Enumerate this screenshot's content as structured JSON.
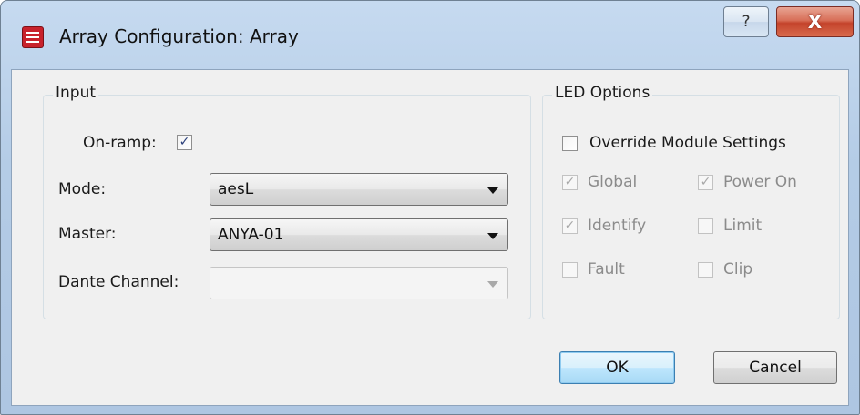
{
  "window": {
    "title": "Array Configuration: Array",
    "help_glyph": "?",
    "close_glyph": "X",
    "app_icon": "app-logo-icon",
    "app_icon_color": "#c8222c"
  },
  "input_group": {
    "title": "Input",
    "on_ramp": {
      "label": "On-ramp:",
      "checked": true
    },
    "mode": {
      "label": "Mode:",
      "value": "aesL"
    },
    "master": {
      "label": "Master:",
      "value": "ANYA-01"
    },
    "dante_channel": {
      "label": "Dante Channel:",
      "value": "",
      "enabled": false
    }
  },
  "led_group": {
    "title": "LED Options",
    "override": {
      "label": "Override Module Settings",
      "checked": false
    },
    "options": {
      "global": {
        "label": "Global",
        "checked": true,
        "enabled": false
      },
      "power_on": {
        "label": "Power On",
        "checked": true,
        "enabled": false
      },
      "identify": {
        "label": "Identify",
        "checked": true,
        "enabled": false
      },
      "limit": {
        "label": "Limit",
        "checked": false,
        "enabled": false
      },
      "fault": {
        "label": "Fault",
        "checked": false,
        "enabled": false
      },
      "clip": {
        "label": "Clip",
        "checked": false,
        "enabled": false
      }
    }
  },
  "buttons": {
    "ok": "OK",
    "cancel": "Cancel"
  },
  "check_glyph": "✓"
}
